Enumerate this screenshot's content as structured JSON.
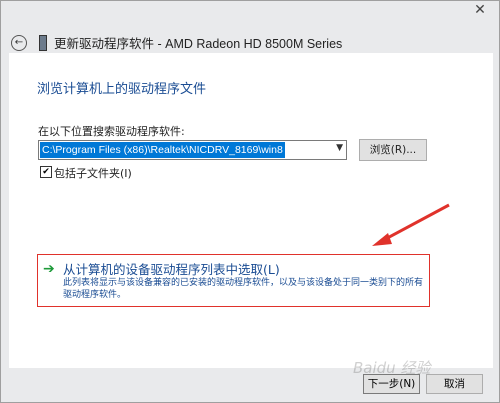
{
  "window": {
    "close_glyph": "✕",
    "back_glyph": "←",
    "title": "更新驱动程序软件 - AMD Radeon HD 8500M Series"
  },
  "page": {
    "heading": "浏览计算机上的驱动程序文件",
    "search_label": "在以下位置搜索驱动程序软件:",
    "path_value": "C:\\Program Files (x86)\\Realtek\\NICDRV_8169\\win8",
    "browse_label": "浏览(R)...",
    "include_subfolders_label": "包括子文件夹(I)",
    "include_subfolders_checked": true
  },
  "pick_option": {
    "title": "从计算机的设备驱动程序列表中选取(L)",
    "description": "此列表将显示与该设备兼容的已安装的驱动程序软件，以及与该设备处于同一类别下的所有驱动程序软件。"
  },
  "footer": {
    "next_label": "下一步(N)",
    "cancel_label": "取消"
  },
  "colors": {
    "heading_blue": "#1a4c93",
    "annotation_red": "#e0322b",
    "selection_blue": "#0078d7"
  }
}
